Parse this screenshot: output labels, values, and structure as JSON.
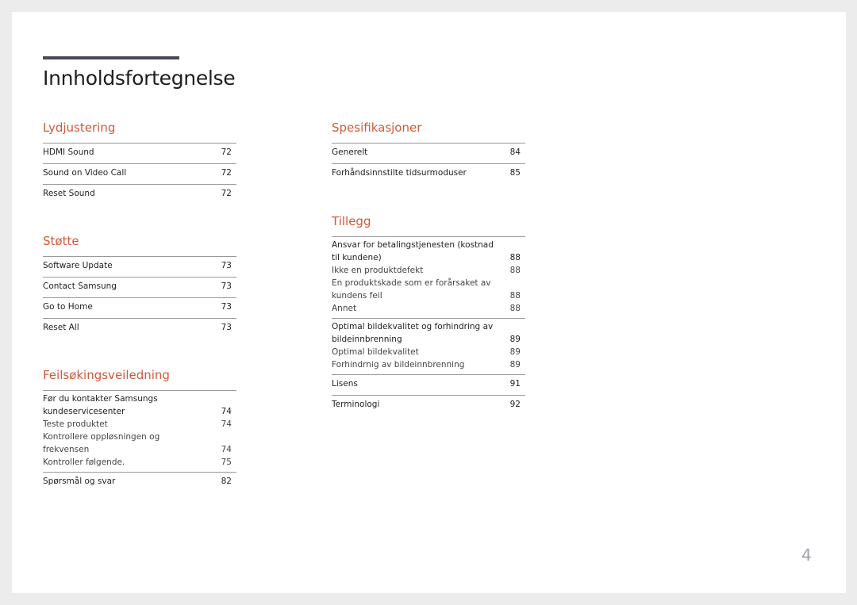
{
  "page_title": "Innholdsfortegnelse",
  "page_number": "4",
  "accent_color": "#d0593a",
  "sections": [
    {
      "title": "Lydjustering",
      "groups": [
        [
          {
            "label": "HDMI Sound",
            "page": "72"
          }
        ],
        [
          {
            "label": "Sound on Video Call",
            "page": "72"
          }
        ],
        [
          {
            "label": "Reset Sound",
            "page": "72"
          }
        ]
      ]
    },
    {
      "title": "Støtte",
      "groups": [
        [
          {
            "label": "Software Update",
            "page": "73"
          }
        ],
        [
          {
            "label": "Contact Samsung",
            "page": "73"
          }
        ],
        [
          {
            "label": "Go to Home",
            "page": "73"
          }
        ],
        [
          {
            "label": "Reset All",
            "page": "73"
          }
        ]
      ]
    },
    {
      "title": "Feilsøkingsveiledning",
      "groups": [
        [
          {
            "label": "Før du kontakter Samsungs kundeservicesenter",
            "page": "74"
          },
          {
            "label": "Teste produktet",
            "page": "74",
            "sub": true
          },
          {
            "label": "Kontrollere oppløsningen og frekvensen",
            "page": "74",
            "sub": true
          },
          {
            "label": "Kontroller følgende.",
            "page": "75",
            "sub": true
          }
        ],
        [
          {
            "label": "Spørsmål og svar",
            "page": "82"
          }
        ]
      ]
    },
    {
      "title": "Spesifikasjoner",
      "groups": [
        [
          {
            "label": "Generelt",
            "page": "84"
          }
        ],
        [
          {
            "label": "Forhåndsinnstilte tidsurmoduser",
            "page": "85"
          }
        ]
      ]
    },
    {
      "title": "Tillegg",
      "groups": [
        [
          {
            "label": "Ansvar for betalingstjenesten (kostnad til kundene)",
            "page": "88"
          },
          {
            "label": "Ikke en produktdefekt",
            "page": "88",
            "sub": true
          },
          {
            "label": "En produktskade som er forårsaket av kundens feil",
            "page": "88",
            "sub": true
          },
          {
            "label": "Annet",
            "page": "88",
            "sub": true
          }
        ],
        [
          {
            "label": "Optimal bildekvalitet og forhindring av bildeinnbrenning",
            "page": "89"
          },
          {
            "label": "Optimal bildekvalitet",
            "page": "89",
            "sub": true
          },
          {
            "label": "Forhindrnig av bildeinnbrenning",
            "page": "89",
            "sub": true
          }
        ],
        [
          {
            "label": "Lisens",
            "page": "91"
          }
        ],
        [
          {
            "label": "Terminologi",
            "page": "92"
          }
        ]
      ]
    }
  ]
}
